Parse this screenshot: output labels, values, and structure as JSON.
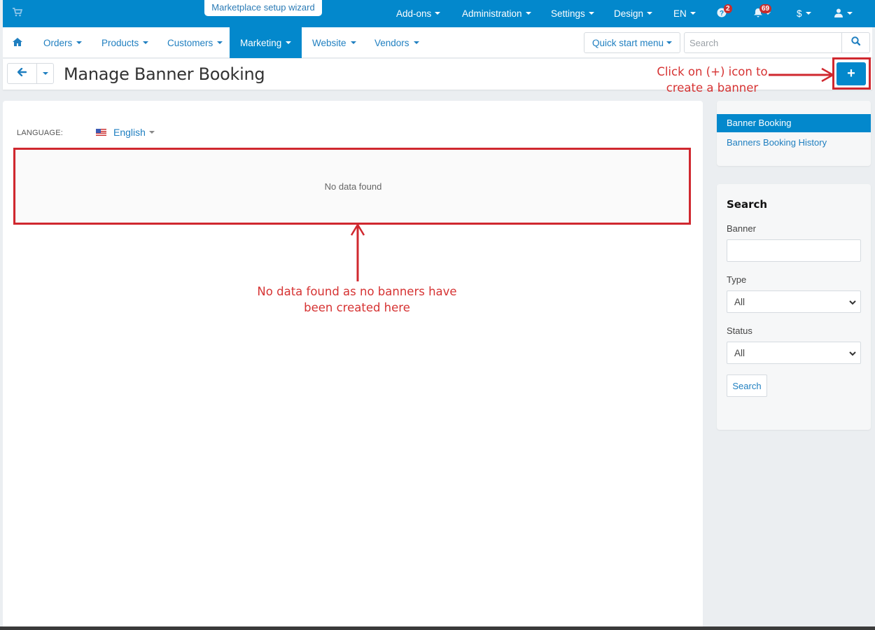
{
  "topbar": {
    "cart_icon": "shopping-cart-icon",
    "wizard_label": "Marketplace setup wizard",
    "menus": [
      {
        "label": "Add-ons"
      },
      {
        "label": "Administration"
      },
      {
        "label": "Settings"
      },
      {
        "label": "Design"
      },
      {
        "label": "EN"
      }
    ],
    "help_badge": "2",
    "notifications_badge": "69",
    "currency_label": "$",
    "user_icon": "user-icon",
    "brand_color": "#0388cc",
    "badge_color": "#c72e2e"
  },
  "navbar": {
    "home_icon": "home-icon",
    "items": [
      {
        "label": "Orders",
        "active": false
      },
      {
        "label": "Products",
        "active": false
      },
      {
        "label": "Customers",
        "active": false
      },
      {
        "label": "Marketing",
        "active": true
      },
      {
        "label": "Website",
        "active": false
      },
      {
        "label": "Vendors",
        "active": false
      }
    ],
    "quick_start_label": "Quick start menu",
    "search": {
      "placeholder": "Search",
      "value": ""
    }
  },
  "header": {
    "title": "Manage Banner Booking",
    "add_button_label": "+"
  },
  "main": {
    "language_label": "LANGUAGE:",
    "language_value": "English",
    "empty_message": "No data found"
  },
  "annotations": {
    "add_hint_line1": "Click on (+) icon to",
    "add_hint_line2": "create a banner",
    "empty_hint_line1": "No data found as no banners have",
    "empty_hint_line2": "been created here",
    "color": "#d0282f"
  },
  "sidebar": {
    "nav": [
      {
        "label": "Banner Booking",
        "active": true
      },
      {
        "label": "Banners Booking History",
        "active": false
      }
    ],
    "search": {
      "title": "Search",
      "banner_label": "Banner",
      "banner_value": "",
      "type_label": "Type",
      "type_value": "All",
      "status_label": "Status",
      "status_value": "All",
      "submit_label": "Search"
    }
  }
}
